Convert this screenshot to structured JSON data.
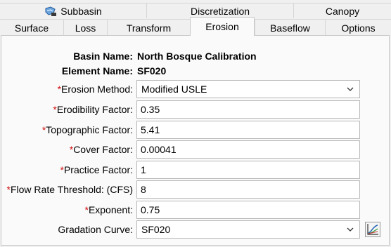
{
  "tabs_top": [
    {
      "label": "Subbasin",
      "icon": "subbasin-icon"
    },
    {
      "label": "Discretization"
    },
    {
      "label": "Canopy"
    }
  ],
  "tabs_bottom": [
    {
      "label": "Surface"
    },
    {
      "label": "Loss"
    },
    {
      "label": "Transform"
    },
    {
      "label": "Erosion",
      "selected": true
    },
    {
      "label": "Baseflow"
    },
    {
      "label": "Options"
    }
  ],
  "basin": {
    "label": "Basin Name:",
    "value": "North Bosque Calibration"
  },
  "element": {
    "label": "Element Name:",
    "value": "SF020"
  },
  "required_mark": "*",
  "fields": {
    "erosion_method": {
      "label": "Erosion Method:",
      "value": "Modified USLE"
    },
    "erodibility": {
      "label": "Erodibility Factor:",
      "value": "0.35"
    },
    "topographic": {
      "label": "Topographic Factor:",
      "value": "5.41"
    },
    "cover": {
      "label": "Cover Factor:",
      "value": "0.00041"
    },
    "practice": {
      "label": "Practice Factor:",
      "value": "1"
    },
    "flow_threshold": {
      "label": "Flow Rate Threshold: (CFS)",
      "value": "8"
    },
    "exponent": {
      "label": "Exponent:",
      "value": "0.75"
    },
    "gradation": {
      "label": "Gradation Curve:",
      "value": "SF020"
    }
  },
  "colors": {
    "required": "#d01010",
    "panel": "#fafafa",
    "background": "#f0f0f0"
  },
  "icons": {
    "dropdown": "chevron-down-icon",
    "plot": "plot-curve-icon"
  }
}
